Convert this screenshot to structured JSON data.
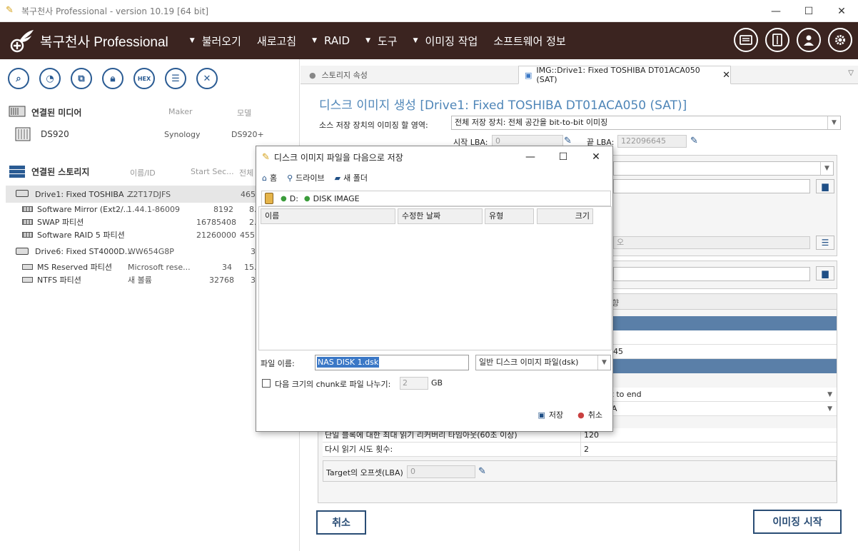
{
  "titlebar": {
    "title": "복구천사 Professional - version 10.19 [64 bit]"
  },
  "header": {
    "logo_text": "복구천사 Professional",
    "menu": [
      {
        "label": "불러오기",
        "has_arrow": true
      },
      {
        "label": "새로고침",
        "has_arrow": false
      },
      {
        "label": "RAID",
        "has_arrow": true
      },
      {
        "label": "도구",
        "has_arrow": true
      },
      {
        "label": "이미징 작업",
        "has_arrow": true
      },
      {
        "label": "소프트웨어 정보",
        "has_arrow": false
      }
    ],
    "icons": [
      "panel-icon",
      "drive-icon",
      "user-icon",
      "gear-icon"
    ]
  },
  "left": {
    "toolbar": [
      "search-icon",
      "disk-scan-icon",
      "clone-icon",
      "lock-icon",
      "hex-icon",
      "list-icon",
      "close-icon"
    ],
    "hex_label": "HEX",
    "media": {
      "title": "연결된 미디어",
      "col_maker": "Maker",
      "col_model": "모델",
      "rows": [
        {
          "name": "DS920",
          "maker": "Synology",
          "model": "DS920+"
        }
      ]
    },
    "storage": {
      "title": "연결된 스토리지",
      "col_name": "이름/ID",
      "col_start": "Start Sec...",
      "col_total": "전체",
      "rows": [
        {
          "name": "Drive1: Fixed TOSHIBA ...",
          "id": "Z2T17DJFS",
          "start": "",
          "total": "465.",
          "kind": "drive",
          "selected": true
        },
        {
          "name": "Software Mirror (Ext2/...",
          "id": "1.44.1-86009",
          "start": "8192",
          "total": "8.",
          "kind": "part"
        },
        {
          "name": "SWAP 파티션",
          "id": "",
          "start": "16785408",
          "total": "2.",
          "kind": "part"
        },
        {
          "name": "Software RAID 5 파티션",
          "id": "",
          "start": "21260000",
          "total": "455.",
          "kind": "part"
        },
        {
          "name": "Drive6: Fixed ST4000D...",
          "id": "WW654G8P",
          "start": "",
          "total": "3.",
          "kind": "drive"
        },
        {
          "name": "MS Reserved 파티션",
          "id": "Microsoft rese...",
          "start": "34",
          "total": "15.",
          "kind": "part"
        },
        {
          "name": "NTFS 파티션",
          "id": "새 볼륨",
          "start": "32768",
          "total": "3.",
          "kind": "part"
        }
      ]
    }
  },
  "right": {
    "tabs": [
      {
        "label": "스토리지 속성"
      },
      {
        "label": "IMG::Drive1: Fixed TOSHIBA DT01ACA050 (SAT)"
      }
    ],
    "page_title": "디스크 이미지 생성 [Drive1: Fixed TOSHIBA DT01ACA050 (SAT)]",
    "source_label": "소스 저장 장치의 이미징 할 영역:",
    "source_value": "전체 저장 장치: 전체 공간을 bit-to-bit 이미징",
    "start_lba_label": "시작 LBA:",
    "start_lba": "0",
    "end_lba_label": "끝 LBA:",
    "end_lba": "122096645",
    "hidden_fragments": {
      "placeholder_tail": "오",
      "grid_value1": "45",
      "grid_value2": "rt to end",
      "grid_value3": "TA",
      "tab_tail": "향"
    },
    "grid_rows": [
      {
        "label": "단일 블록에 대한 최대 읽기 리커버리 타임아웃(60초 이상)",
        "value": "120"
      },
      {
        "label": "다시 읽기 시도 횟수:",
        "value": "2"
      }
    ],
    "target_offset_label": "Target의 오프셋(LBA)",
    "target_offset": "0",
    "cancel_button": "취소",
    "start_button": "이미징 시작"
  },
  "dialog": {
    "title": "디스크 이미지 파일을 다음으로 저장",
    "nav": [
      {
        "icon": "home-icon",
        "label": "홈"
      },
      {
        "icon": "drives-icon",
        "label": "드라이브"
      },
      {
        "icon": "new-folder-icon",
        "label": "새 폴더"
      }
    ],
    "path": [
      "D:",
      "DISK IMAGE"
    ],
    "columns": [
      "이름",
      "수정한 날짜",
      "유형",
      "크기"
    ],
    "filename_label": "파일 이름:",
    "filename": "NAS DISK 1.dsk",
    "filetype": "일반 디스크 이미지 파일(dsk)",
    "chunk_label": "다음 크기의 chunk로 파일 나누기:",
    "chunk_value": "2",
    "chunk_unit": "GB",
    "save_label": "저장",
    "cancel_label": "취소"
  }
}
